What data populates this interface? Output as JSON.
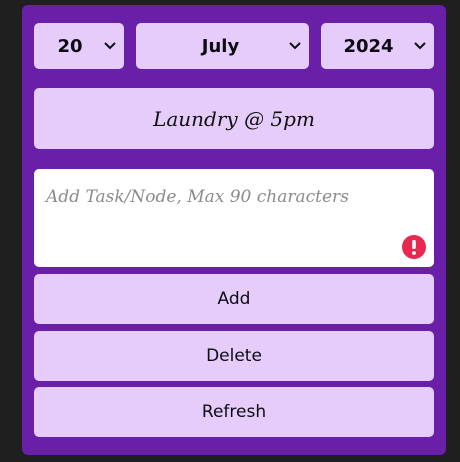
{
  "date_selectors": {
    "day": "20",
    "month": "July",
    "year": "2024"
  },
  "selected_task": {
    "text": "Laundry @ 5pm"
  },
  "task_input": {
    "placeholder": "Add Task/Node, Max 90 characters",
    "value": "",
    "error_icon": "exclamation-circle-icon"
  },
  "buttons": {
    "add": "Add",
    "delete": "Delete",
    "refresh": "Refresh"
  },
  "colors": {
    "background": "#1f1f1f",
    "panel": "#6a1fa8",
    "control": "#e6ccfb",
    "input": "#ffffff",
    "error": "#e8294f"
  }
}
